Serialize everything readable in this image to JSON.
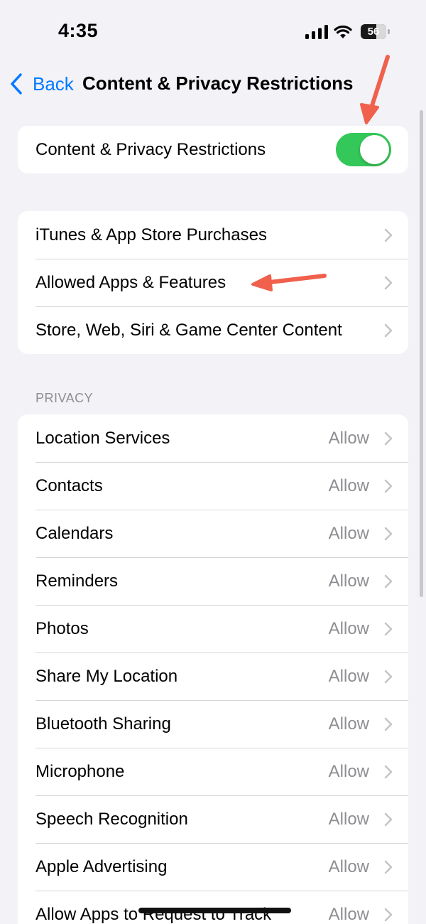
{
  "status_bar": {
    "time": "4:35",
    "battery_level": "56",
    "icons": [
      "signal-icon",
      "wifi-icon",
      "battery-icon"
    ]
  },
  "nav": {
    "back_label": "Back",
    "title": "Content & Privacy Restrictions"
  },
  "toggle_group": {
    "label": "Content & Privacy Restrictions",
    "toggle_on": true,
    "toggle_color": "#34c759"
  },
  "store_group": {
    "items": [
      {
        "label": "iTunes & App Store Purchases"
      },
      {
        "label": "Allowed Apps & Features"
      },
      {
        "label": "Store, Web, Siri & Game Center Content"
      }
    ]
  },
  "privacy": {
    "header": "PRIVACY",
    "items": [
      {
        "label": "Location Services",
        "value": "Allow"
      },
      {
        "label": "Contacts",
        "value": "Allow"
      },
      {
        "label": "Calendars",
        "value": "Allow"
      },
      {
        "label": "Reminders",
        "value": "Allow"
      },
      {
        "label": "Photos",
        "value": "Allow"
      },
      {
        "label": "Share My Location",
        "value": "Allow"
      },
      {
        "label": "Bluetooth Sharing",
        "value": "Allow"
      },
      {
        "label": "Microphone",
        "value": "Allow"
      },
      {
        "label": "Speech Recognition",
        "value": "Allow"
      },
      {
        "label": "Apple Advertising",
        "value": "Allow"
      },
      {
        "label": "Allow Apps to Request to Track",
        "value": "Allow"
      }
    ]
  },
  "colors": {
    "accent": "#007aff",
    "annotation": "#f0604d",
    "background": "#f2f2f7",
    "secondary_text": "#8e8e93"
  }
}
